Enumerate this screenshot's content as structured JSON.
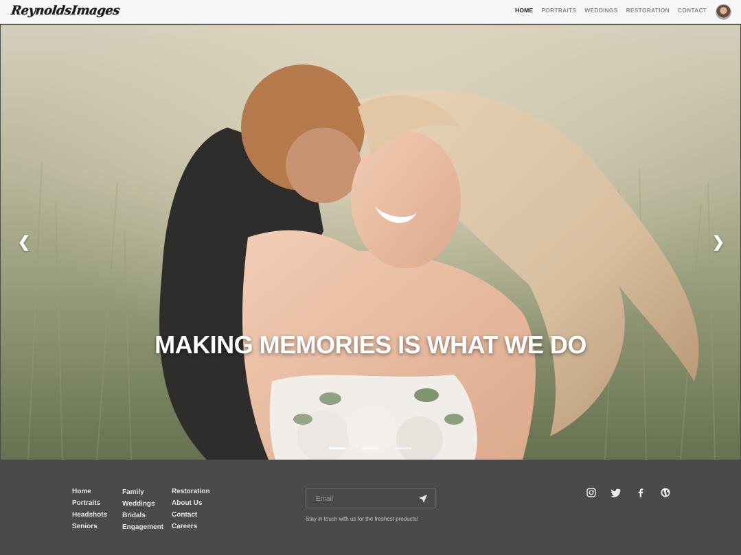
{
  "brand": {
    "logo_text": "ReynoldsImages"
  },
  "nav": {
    "items": [
      {
        "label": "HOME",
        "active": true
      },
      {
        "label": "PORTRAITS",
        "active": false
      },
      {
        "label": "WEDDINGS",
        "active": false
      },
      {
        "label": "RESTORATION",
        "active": false
      },
      {
        "label": "CONTACT",
        "active": false
      }
    ]
  },
  "hero": {
    "headline": "MAKING MEMORIES IS WHAT WE DO",
    "prev_icon": "chevron-left-icon",
    "next_icon": "chevron-right-icon",
    "slide_count": 3,
    "active_slide": 1
  },
  "footer": {
    "links_col1": [
      "Home",
      "Portraits",
      "Headshots",
      "Seniors"
    ],
    "links_col2": [
      "Family",
      "Weddings",
      "Bridals",
      "Engagement"
    ],
    "links_col3": [
      "Restoration",
      "About Us",
      "Contact",
      "Careers"
    ],
    "email_placeholder": "Email",
    "tagline": "Stay in touch with us for the freshest products!",
    "social_icons": [
      "instagram-icon",
      "twitter-icon",
      "facebook-icon",
      "globe-icon"
    ]
  },
  "colors": {
    "header_bg": "#f6f7f9",
    "footer_bg": "#4a4a4a",
    "nav_active": "#222222",
    "nav_inactive": "#8a8a8a",
    "footer_text": "#e6e6e6"
  }
}
